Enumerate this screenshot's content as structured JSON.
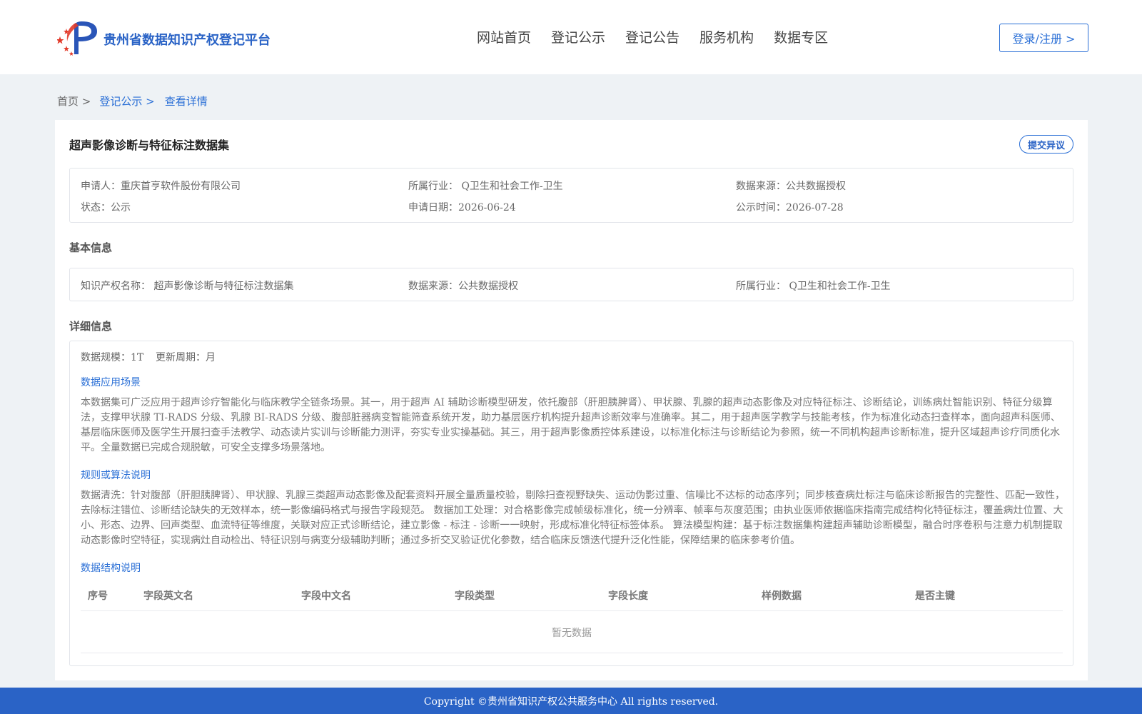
{
  "header": {
    "brand": "贵州省数据知识产权登记平台",
    "nav": [
      "网站首页",
      "登记公示",
      "登记公告",
      "服务机构",
      "数据专区"
    ],
    "login_label": "登录/注册 >"
  },
  "breadcrumb": {
    "home": "首页 >",
    "list": "登记公示 >",
    "current": "查看详情"
  },
  "record": {
    "title": "超声影像诊断与特征标注数据集",
    "objection_label": "提交异议",
    "summary": {
      "applicant": "申请人：重庆首亨软件股份有限公司",
      "industry": "所属行业： Q卫生和社会工作-卫生",
      "source": "数据来源：公共数据授权",
      "status": "状态：公示",
      "apply_date": "申请日期：2026-06-24",
      "publicity_time": "公示时间：2026-07-28"
    }
  },
  "basic": {
    "heading": "基本信息",
    "ip_name": "知识产权名称： 超声影像诊断与特征标注数据集",
    "source": "数据来源：公共数据授权",
    "industry": "所属行业： Q卫生和社会工作-卫生"
  },
  "detail": {
    "heading": "详细信息",
    "scale": "数据规模：1T",
    "update_cycle": "更新周期：月",
    "scenario_title": "数据应用场景",
    "scenario_text": "本数据集可广泛应用于超声诊疗智能化与临床教学全链条场景。其一，用于超声 AI 辅助诊断模型研发，依托腹部（肝胆胰脾肾）、甲状腺、乳腺的超声动态影像及对应特征标注、诊断结论，训练病灶智能识别、特征分级算法，支撑甲状腺 TI-RADS 分级、乳腺 BI-RADS 分级、腹部脏器病变智能筛查系统开发，助力基层医疗机构提升超声诊断效率与准确率。其二，用于超声医学教学与技能考核，作为标准化动态扫查样本，面向超声科医师、基层临床医师及医学生开展扫查手法教学、动态读片实训与诊断能力测评，夯实专业实操基础。其三，用于超声影像质控体系建设，以标准化标注与诊断结论为参照，统一不同机构超声诊断标准，提升区域超声诊疗同质化水平。全量数据已完成合规脱敏，可安全支撑多场景落地。",
    "algorithm_title": "规则或算法说明",
    "algorithm_text": "数据清洗：针对腹部（肝胆胰脾肾）、甲状腺、乳腺三类超声动态影像及配套资料开展全量质量校验，剔除扫查视野缺失、运动伪影过重、信噪比不达标的动态序列；同步核查病灶标注与临床诊断报告的完整性、匹配一致性，去除标注错位、诊断结论缺失的无效样本，统一影像编码格式与报告字段规范。 数据加工处理：对合格影像完成帧级标准化，统一分辨率、帧率与灰度范围；由执业医师依据临床指南完成结构化特征标注，覆盖病灶位置、大小、形态、边界、回声类型、血流特征等维度，关联对应正式诊断结论，建立影像 - 标注 - 诊断一一映射，形成标准化特征标签体系。 算法模型构建：基于标注数据集构建超声辅助诊断模型，融合时序卷积与注意力机制提取动态影像时空特征，实现病灶自动检出、特征识别与病变分级辅助判断；通过多折交叉验证优化参数，结合临床反馈迭代提升泛化性能，保障结果的临床参考价值。",
    "structure_title": "数据结构说明",
    "table_headers": [
      "序号",
      "字段英文名",
      "字段中文名",
      "字段类型",
      "字段长度",
      "样例数据",
      "是否主键"
    ],
    "table_empty": "暂无数据"
  },
  "footer": {
    "copyright": "Copyright ©贵州省知识产权公共服务中心 All rights reserved."
  },
  "colors": {
    "accent": "#2a6fd6",
    "footer_bg": "#2a63c6",
    "logo_red": "#e23a2a",
    "logo_blue": "#2a55b8"
  },
  "icons": {
    "logo": "stars-p-logo"
  }
}
